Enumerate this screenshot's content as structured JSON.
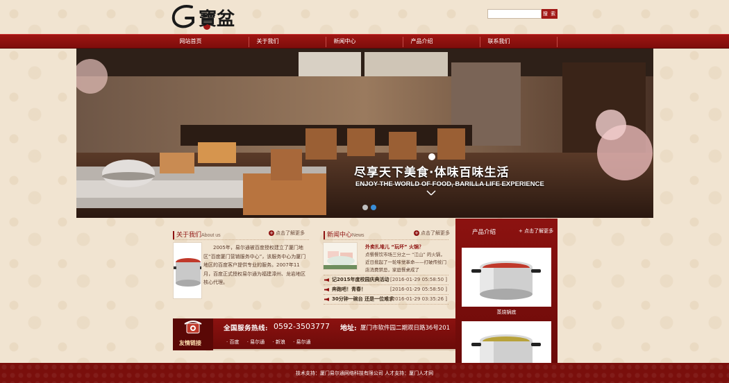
{
  "header": {
    "search": {
      "placeholder": "",
      "button_label": "搜 索"
    }
  },
  "nav": {
    "items": [
      {
        "label": "网站首页"
      },
      {
        "label": "关于我们"
      },
      {
        "label": "新闻中心"
      },
      {
        "label": "产品介绍"
      },
      {
        "label": "联系我们"
      }
    ]
  },
  "banner": {
    "headline": "尽享天下美食·体味百味生活",
    "subline": "ENJOY THE WORLD OF FOOD, BARILLA LIFE EXPERIENCE",
    "active_slide": 2,
    "slide_count": 2
  },
  "about": {
    "title": "关于我们",
    "title_en": "About us",
    "more": "点击了解更多",
    "text": "2005年，易尔通被百度授权建立了厦门地区“百度厦门营销服务中心”，该服务中心为厦门地区的百度客户提供专业的服务。2007年11月，百度正式授权易尔通为福建漳州、龙岩地区核心代理。"
  },
  "news": {
    "title": "新闻中心",
    "title_en": "News",
    "more": "点击了解更多",
    "featured": {
      "headline": "外卖扎堆儿 “玩坏” 火锅？",
      "excerpt": "点餐餐饮市场三分之一 “江山” 的火锅，近日掀起了一轮味觉革命——打破传统门店消费禁忌，家庭餐桌成了"
    },
    "items": [
      {
        "title": "记2015年度校园庆典活动",
        "date": "[2016-01-29 05:58:50 ]"
      },
      {
        "title": "奔跑吧！青春！",
        "date": "[2016-01-29 05:58:50 ]"
      },
      {
        "title": "30分钟一碗台 还是一位难求",
        "date": "[2016-01-29 03:35:26 ]"
      }
    ]
  },
  "contact": {
    "links_label": "友情链接",
    "hotline_label": "全国服务热线:",
    "phone": "0592-3503777",
    "address_label": "地址:",
    "address": "厦门市软件园二期观日路36号201",
    "links": [
      "百度",
      "易尔通",
      "新浪",
      "易尔通"
    ]
  },
  "products": {
    "title": "产品介绍",
    "more": "+ 点击了解更多",
    "items": [
      {
        "name": "蒸烧锅底"
      },
      {
        "name": ""
      }
    ]
  },
  "footer": {
    "text": "技术支持：厦门易尔通网络科技有限公司 人才支持：厦门人才网"
  },
  "colors": {
    "brand_red": "#8e1210",
    "nav_red": "#9e1512",
    "background": "#f1e4d1"
  }
}
